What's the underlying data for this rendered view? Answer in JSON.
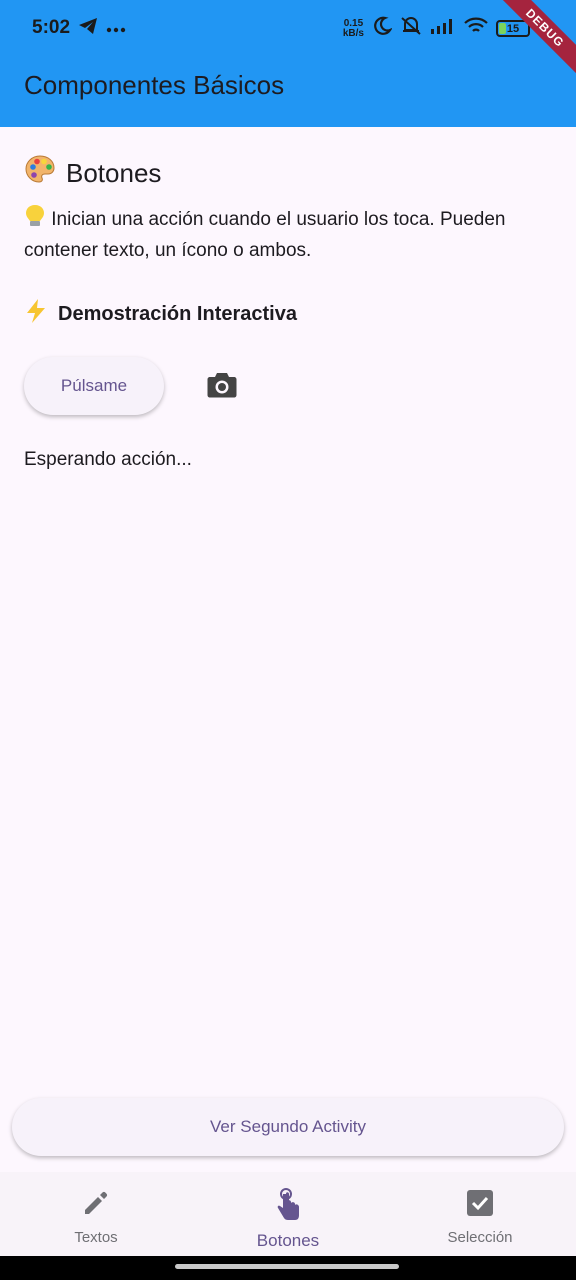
{
  "status_bar": {
    "time": "5:02",
    "net_speed_value": "0.15",
    "net_speed_unit": "kB/s",
    "battery": "15",
    "debug_label": "DEBUG"
  },
  "app_bar": {
    "title": "Componentes Básicos"
  },
  "section": {
    "title": "Botones",
    "title_icon": "palette-emoji",
    "description_icon": "lightbulb-emoji",
    "description": "Inician una acción cuando el usuario los toca. Pueden contener texto, un ícono o ambos."
  },
  "demo": {
    "title": "Demostración Interactiva",
    "title_icon": "lightning-emoji",
    "button_label": "Púlsame",
    "icon_button": "camera-icon",
    "status": "Esperando acción..."
  },
  "second_activity_button": "Ver Segundo Activity",
  "bottom_nav": {
    "items": [
      {
        "label": "Textos",
        "icon": "edit-icon",
        "active": false
      },
      {
        "label": "Botones",
        "icon": "touch-icon",
        "active": true
      },
      {
        "label": "Selección",
        "icon": "checkbox-icon",
        "active": false
      }
    ]
  },
  "colors": {
    "app_bar": "#2196f3",
    "accent": "#65558f",
    "background": "#fdf7fe"
  }
}
